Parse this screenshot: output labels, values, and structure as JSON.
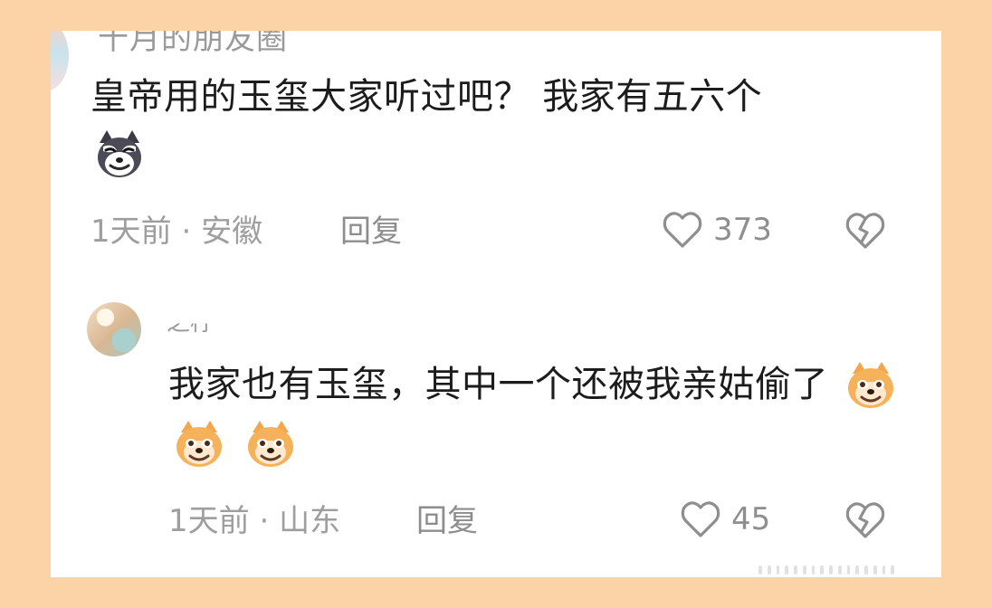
{
  "comments": [
    {
      "author": "十月的朋友圈",
      "text": "皇帝用的玉玺大家听过吧？ 我家有五六个",
      "emoji": "husky-emoji",
      "time": "1天前",
      "location": "安徽",
      "reply_label": "回复",
      "likes": "373"
    },
    {
      "author": "之柠",
      "text": "我家也有玉玺，其中一个还被我亲姑偷了",
      "emoji": "shiba-emoji",
      "time": "1天前",
      "location": "山东",
      "reply_label": "回复",
      "likes": "45"
    }
  ],
  "colors": {
    "page_background": "#fbd3a6",
    "card_background": "#ffffff",
    "text_primary": "#1c1c1c",
    "text_secondary": "#9e9e9e"
  }
}
